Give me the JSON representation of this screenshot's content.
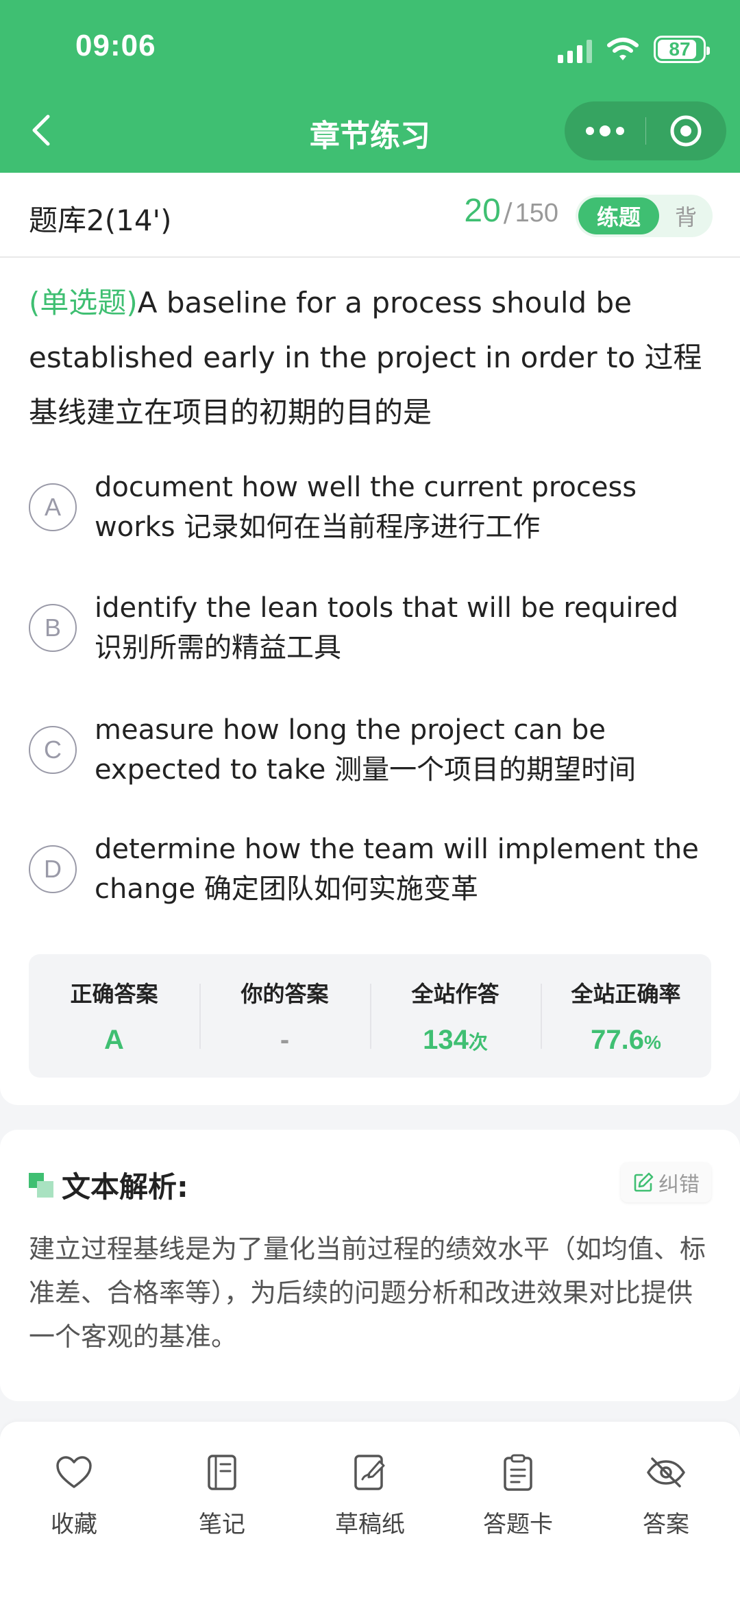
{
  "status_bar": {
    "time": "09:06",
    "battery": "87",
    "battery_level": 0.87
  },
  "nav": {
    "title": "章节练习"
  },
  "question_bar": {
    "bank_name": "题库2(14')",
    "current": "20",
    "separator": "/",
    "total": "150",
    "mode_active": "练题",
    "mode_inactive": "背"
  },
  "question": {
    "type_label": "(单选题)",
    "stem": "A baseline for a process should be established early in the project in order to 过程基线建立在项目的初期的目的是",
    "options": [
      {
        "letter": "A",
        "text": "document how well the current process works 记录如何在当前程序进行工作"
      },
      {
        "letter": "B",
        "text": "identify the lean tools that will be required 识别所需的精益工具"
      },
      {
        "letter": "C",
        "text": "measure how long the project can be expected to take 测量一个项目的期望时间"
      },
      {
        "letter": "D",
        "text": "determine how the team will implement the change 确定团队如何实施变革"
      }
    ]
  },
  "stats": {
    "correct_label": "正确答案",
    "correct_value": "A",
    "yours_label": "你的答案",
    "yours_value": "-",
    "attempts_label": "全站作答",
    "attempts_value": "134",
    "attempts_unit": "次",
    "rate_label": "全站正确率",
    "rate_value": "77.6",
    "rate_unit": "%"
  },
  "analysis": {
    "title": "文本解析:",
    "report_label": "纠错",
    "body": "建立过程基线是为了量化当前过程的绩效水平（如均值、标准差、合格率等），为后续的问题分析和改进效果对比提供一个客观的基准。"
  },
  "bottom_tabs": [
    {
      "label": "收藏",
      "icon": "heart-icon"
    },
    {
      "label": "笔记",
      "icon": "notebook-icon"
    },
    {
      "label": "草稿纸",
      "icon": "draft-icon"
    },
    {
      "label": "答题卡",
      "icon": "clipboard-icon"
    },
    {
      "label": "答案",
      "icon": "eye-off-icon"
    }
  ],
  "colors": {
    "accent": "#3fbf72",
    "text": "#222222",
    "muted": "#999999"
  }
}
